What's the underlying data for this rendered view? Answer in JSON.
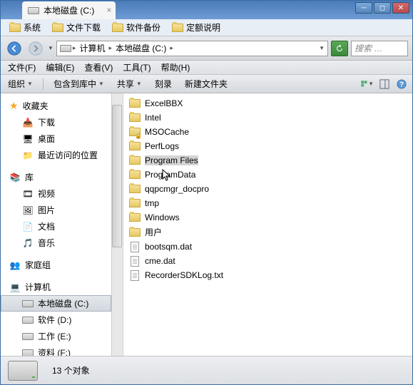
{
  "tab": {
    "title": "本地磁盘 (C:)"
  },
  "bookmarks": [
    {
      "label": "系统"
    },
    {
      "label": "文件下载"
    },
    {
      "label": "软件备份"
    },
    {
      "label": "定额说明"
    }
  ],
  "breadcrumb": {
    "segments": [
      "计算机",
      "本地磁盘 (C:)"
    ]
  },
  "search": {
    "placeholder": "搜索 …"
  },
  "menu": {
    "file": "文件(F)",
    "edit": "编辑(E)",
    "view": "查看(V)",
    "tools": "工具(T)",
    "help": "帮助(H)"
  },
  "toolbar": {
    "organize": "组织",
    "include": "包含到库中",
    "share": "共享",
    "burn": "刻录",
    "newfolder": "新建文件夹"
  },
  "sidebar": {
    "favorites": {
      "label": "收藏夹",
      "items": [
        "下载",
        "桌面",
        "最近访问的位置"
      ]
    },
    "libraries": {
      "label": "库",
      "items": [
        "视频",
        "图片",
        "文档",
        "音乐"
      ]
    },
    "homegroup": {
      "label": "家庭组"
    },
    "computer": {
      "label": "计算机",
      "drives": [
        "本地磁盘 (C:)",
        "软件 (D:)",
        "工作 (E:)",
        "资料 (F:)"
      ]
    }
  },
  "files": [
    {
      "name": "ExcelBBX",
      "type": "folder"
    },
    {
      "name": "Intel",
      "type": "folder"
    },
    {
      "name": "MSOCache",
      "type": "folder-locked"
    },
    {
      "name": "PerfLogs",
      "type": "folder"
    },
    {
      "name": "Program Files",
      "type": "folder",
      "selected": true
    },
    {
      "name": "ProgramData",
      "type": "folder"
    },
    {
      "name": "qqpcmgr_docpro",
      "type": "folder"
    },
    {
      "name": "tmp",
      "type": "folder"
    },
    {
      "name": "Windows",
      "type": "folder"
    },
    {
      "name": "用户",
      "type": "folder"
    },
    {
      "name": "bootsqm.dat",
      "type": "file"
    },
    {
      "name": "cme.dat",
      "type": "file"
    },
    {
      "name": "RecorderSDKLog.txt",
      "type": "file"
    }
  ],
  "status": {
    "count_label": "13 个对象"
  }
}
